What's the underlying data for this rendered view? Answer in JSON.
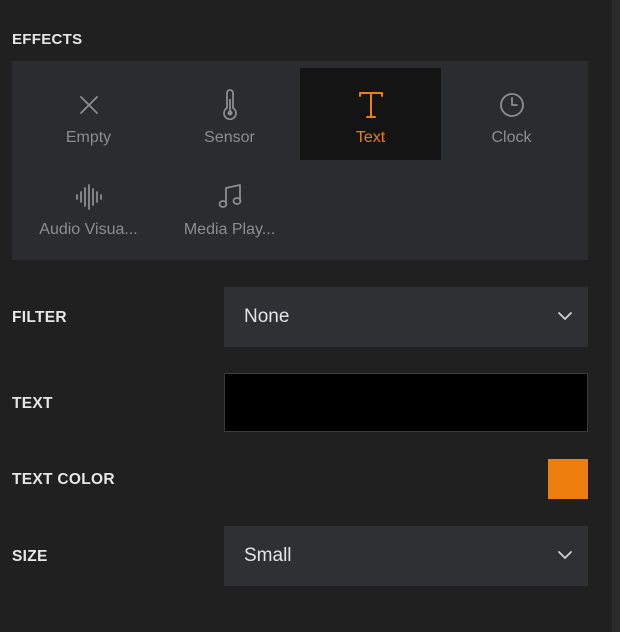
{
  "effects": {
    "title": "EFFECTS",
    "selected": "Text",
    "items": [
      {
        "label": "Empty",
        "icon": "close-icon"
      },
      {
        "label": "Sensor",
        "icon": "thermometer-icon"
      },
      {
        "label": "Text",
        "icon": "text-icon"
      },
      {
        "label": "Clock",
        "icon": "clock-icon"
      },
      {
        "label": "Audio Visua...",
        "icon": "audio-waveform-icon"
      },
      {
        "label": "Media Play...",
        "icon": "music-note-icon"
      }
    ]
  },
  "filter": {
    "label": "FILTER",
    "value": "None"
  },
  "text": {
    "label": "TEXT",
    "value": ""
  },
  "text_color": {
    "label": "TEXT COLOR",
    "color": "#ee7f0e"
  },
  "size": {
    "label": "SIZE",
    "value": "Small"
  },
  "colors": {
    "accent": "#ee7f0e",
    "icon_muted": "#8b8d92"
  }
}
